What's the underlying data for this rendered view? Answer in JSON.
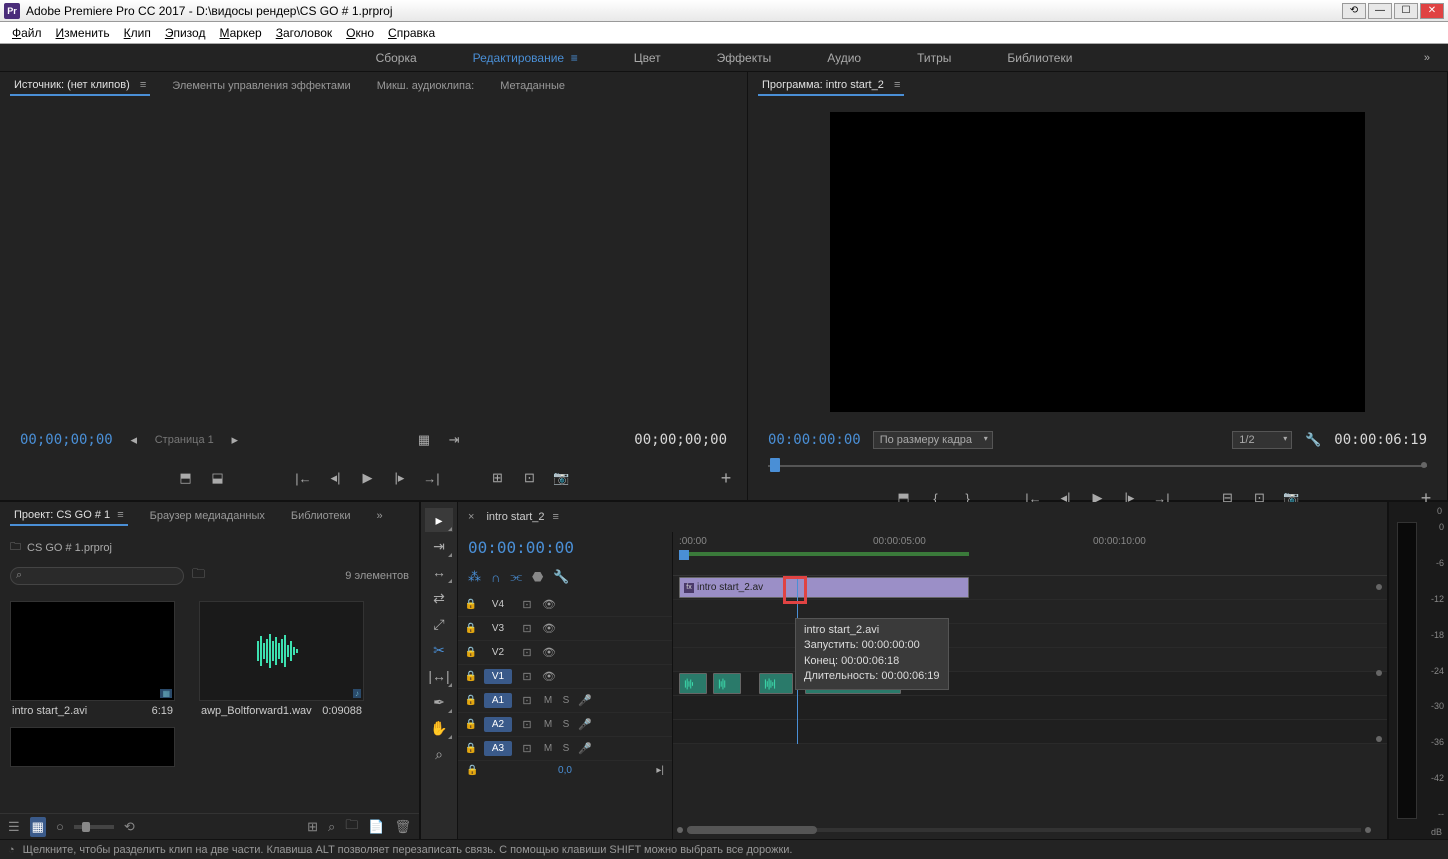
{
  "titlebar": {
    "app": "Adobe Premiere Pro CC 2017",
    "path": "D:\\видосы рендер\\CS GO # 1.prproj"
  },
  "menu": {
    "items": [
      "Файл",
      "Изменить",
      "Клип",
      "Эпизод",
      "Маркер",
      "Заголовок",
      "Окно",
      "Справка"
    ]
  },
  "workspaces": {
    "items": [
      "Сборка",
      "Редактирование",
      "Цвет",
      "Эффекты",
      "Аудио",
      "Титры",
      "Библиотеки"
    ],
    "active": 1
  },
  "source": {
    "tabs": [
      "Источник: (нет клипов)",
      "Элементы управления эффектами",
      "Микш. аудиоклипа:",
      "Метаданные"
    ],
    "time_left": "00;00;00;00",
    "time_right": "00;00;00;00",
    "page": "Страница 1"
  },
  "program": {
    "label": "Программа:",
    "seq": "intro start_2",
    "time_left": "00:00:00:00",
    "time_right": "00:00:06:19",
    "fit": "По размеру кадра",
    "res": "1/2"
  },
  "project": {
    "tabs": [
      "Проект: CS GO # 1",
      "Браузер медиаданных",
      "Библиотеки"
    ],
    "file": "CS GO # 1.prproj",
    "count": "9 элементов",
    "items": [
      {
        "name": "intro start_2.avi",
        "dur": "6:19",
        "type": "video"
      },
      {
        "name": "awp_Boltforward1.wav",
        "dur": "0:09088",
        "type": "audio"
      }
    ]
  },
  "timeline": {
    "seq": "intro start_2",
    "time": "00:00:00:00",
    "ruler": [
      ":00:00",
      "00:00:05:00",
      "00:00:10:00"
    ],
    "vtracks": [
      "V4",
      "V3",
      "V2",
      "V1"
    ],
    "atracks": [
      "A1",
      "A2",
      "A3"
    ],
    "clip_v": "intro start_2.av",
    "zoom": "0,0",
    "tooltip": {
      "name": "intro start_2.avi",
      "start_lbl": "Запустить:",
      "start": "00:00:00:00",
      "end_lbl": "Конец:",
      "end": "00:00:06:18",
      "dur_lbl": "Длительность:",
      "dur": "00:00:06:19"
    }
  },
  "meter": {
    "zero": "0",
    "scale": [
      "0",
      "-6",
      "-12",
      "-18",
      "-24",
      "-30",
      "-36",
      "-42",
      "--"
    ],
    "db": "dB"
  },
  "status": "Щелкните, чтобы разделить клип на две части. Клавиша ALT позволяет перезаписать связь. С помощью клавиши SHIFT можно выбрать все дорожки."
}
